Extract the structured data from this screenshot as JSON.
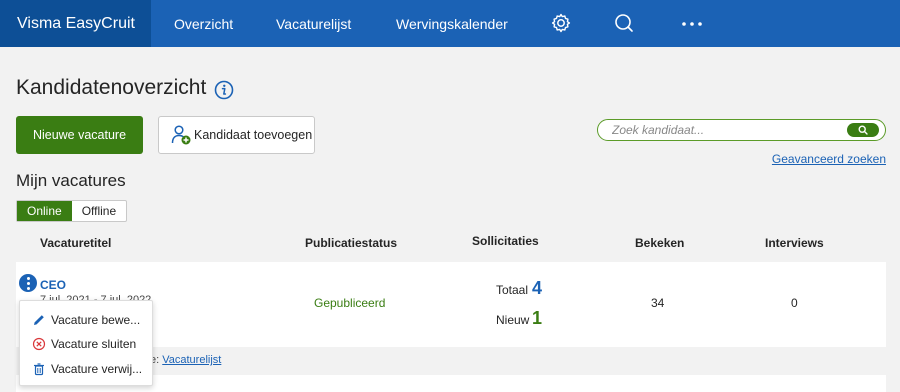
{
  "nav": {
    "brand": "Visma EasyCruit",
    "links": [
      "Overzicht",
      "Vacaturelijst",
      "Wervingskalender"
    ],
    "icons": [
      "gear-icon",
      "search-icon",
      "more-icon"
    ]
  },
  "header": {
    "title": "Kandidatenoverzicht",
    "new_vacancy_label": "Nieuwe vacature",
    "add_candidate_label": "Kandidaat toevoegen",
    "search_placeholder": "Zoek kandidaat...",
    "search_button_label": "Q",
    "advanced_search": "Geavanceerd zoeken"
  },
  "my_vacancies": {
    "title": "Mijn vacatures",
    "toggle": {
      "online": "Online",
      "offline": "Offline",
      "selected": "Online"
    }
  },
  "table": {
    "headers": [
      "Vacaturetitel",
      "Publicatiestatus",
      "Sollicitaties",
      "Bekeken",
      "Interviews"
    ],
    "rows": [
      {
        "title": "CEO",
        "dates": "7 jul. 2021 - 7 jul. 2022",
        "status": "Gepubliceerd",
        "total_label": "Totaal",
        "total": "4",
        "new_label": "Nieuw",
        "new": "1",
        "views": "34",
        "interviews": "0"
      }
    ]
  },
  "footer": {
    "prefix": "e: ",
    "link": "Vacaturelijst"
  },
  "context_menu": {
    "items": [
      {
        "label": "Vacature bewe...",
        "icon": "pencil-icon"
      },
      {
        "label": "Vacature sluiten",
        "icon": "close-circle-icon"
      },
      {
        "label": "Vacature verwij...",
        "icon": "trash-icon"
      }
    ]
  },
  "colors": {
    "nav": "#1b62b5",
    "brand": "#0d4f96",
    "primary_green": "#3a7d13",
    "link_blue": "#1b62b5",
    "delete_red": "#d9373a"
  }
}
